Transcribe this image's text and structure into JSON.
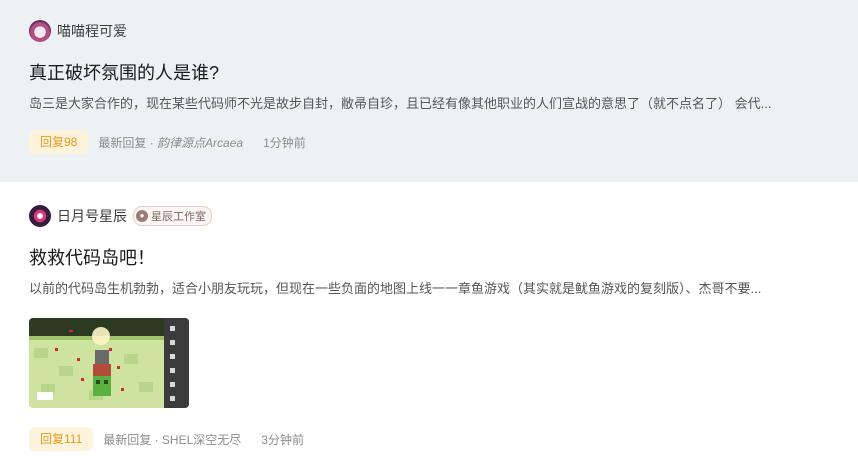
{
  "posts": [
    {
      "author": "喵喵程可爱",
      "title": "真正破坏氛围的人是谁?",
      "excerpt": "岛三是大家合作的，现在某些代码师不光是故步自封，敝帚自珍，且已经有像其他职业的人们宣战的意思了（就不点名了） 会代...",
      "reply_count": "回复98",
      "last_reply_prefix": "最新回复 · ",
      "last_reply_user": "韵律源点Arcaea",
      "time": "1分钟前"
    },
    {
      "author": "日月号星辰",
      "badge": "星辰工作室",
      "title": "救救代码岛吧！",
      "excerpt": "以前的代码岛生机勃勃，适合小朋友玩玩，但现在一些负面的地图上线一一章鱼游戏（其实就是鱿鱼游戏的复刻版）、杰哥不要...",
      "reply_count": "回复111",
      "last_reply_prefix": "最新回复 · ",
      "last_reply_user": "SHEL深空无尽",
      "time": "3分钟前"
    }
  ],
  "colors": {
    "accent_text": "#e79b22",
    "accent_bg": "#fdf3dd",
    "highlight_bg": "#eef1f4"
  }
}
